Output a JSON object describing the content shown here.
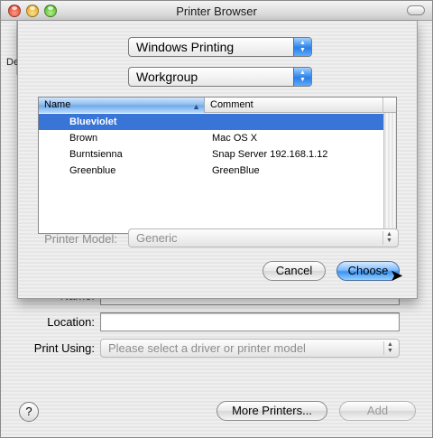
{
  "window": {
    "title": "Printer Browser",
    "partial_toolbar_label": "De"
  },
  "sheet": {
    "protocol_popup": "Windows Printing",
    "workgroup_popup": "Workgroup",
    "table": {
      "headers": [
        "Name",
        "Comment"
      ],
      "rows": [
        {
          "name": "Blueviolet",
          "comment": "",
          "selected": true
        },
        {
          "name": "Brown",
          "comment": "Mac OS X",
          "selected": false
        },
        {
          "name": "Burntsienna",
          "comment": "Snap Server 192.168.1.12",
          "selected": false
        },
        {
          "name": "Greenblue",
          "comment": "GreenBlue",
          "selected": false
        }
      ]
    },
    "printer_model_label": "Printer Model:",
    "printer_model_value": "Generic",
    "cancel_label": "Cancel",
    "choose_label": "Choose"
  },
  "form": {
    "name_label_partial": "Name:",
    "location_label": "Location:",
    "location_value": "",
    "print_using_label": "Print Using:",
    "print_using_value": "Please select a driver or printer model"
  },
  "footer": {
    "help_label": "?",
    "more_printers_label": "More Printers...",
    "add_label": "Add"
  },
  "colors": {
    "selection": "#3875d7",
    "default_button": "#3e93f0"
  }
}
